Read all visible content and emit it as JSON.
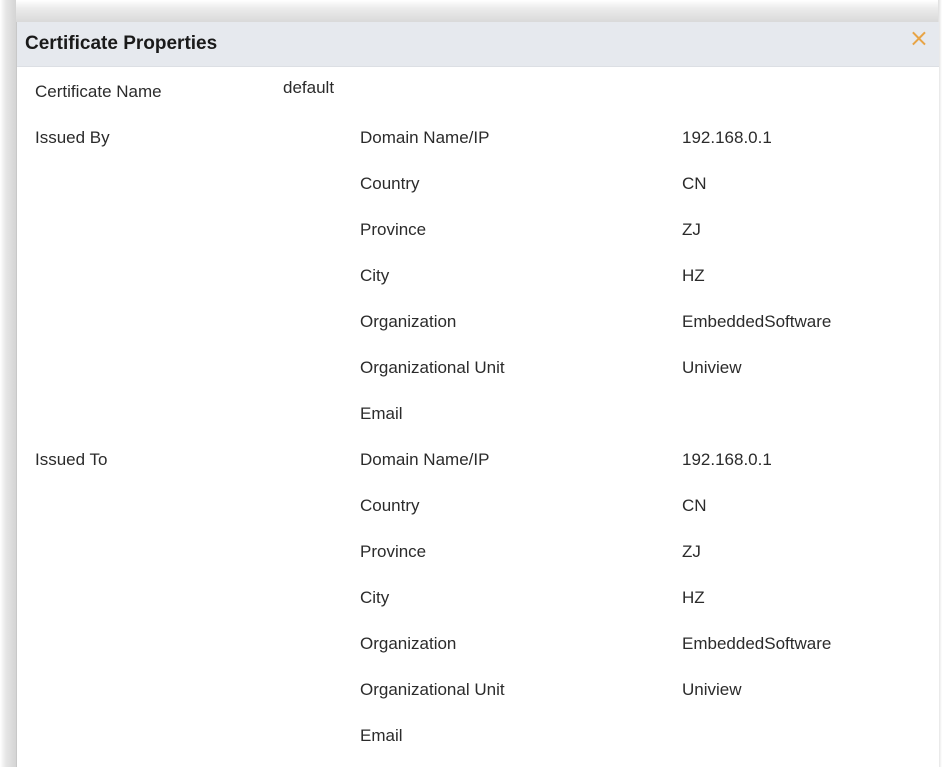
{
  "dialog": {
    "title": "Certificate Properties",
    "close_glyph": "×"
  },
  "certificate": {
    "name_label": "Certificate Name",
    "name_value": "default"
  },
  "issued_by": {
    "label": "Issued By",
    "fields": [
      {
        "label": "Domain Name/IP",
        "value": "192.168.0.1"
      },
      {
        "label": "Country",
        "value": "CN"
      },
      {
        "label": "Province",
        "value": "ZJ"
      },
      {
        "label": "City",
        "value": "HZ"
      },
      {
        "label": "Organization",
        "value": "EmbeddedSoftware"
      },
      {
        "label": "Organizational Unit",
        "value": "Uniview"
      },
      {
        "label": "Email",
        "value": ""
      }
    ]
  },
  "issued_to": {
    "label": "Issued To",
    "fields": [
      {
        "label": "Domain Name/IP",
        "value": "192.168.0.1"
      },
      {
        "label": "Country",
        "value": "CN"
      },
      {
        "label": "Province",
        "value": "ZJ"
      },
      {
        "label": "City",
        "value": "HZ"
      },
      {
        "label": "Organization",
        "value": "EmbeddedSoftware"
      },
      {
        "label": "Organizational Unit",
        "value": "Uniview"
      },
      {
        "label": "Email",
        "value": ""
      }
    ]
  },
  "colors": {
    "title_bar": "#e6e9ee",
    "close_icon": "#e8a445",
    "text": "#2b2b2b"
  }
}
